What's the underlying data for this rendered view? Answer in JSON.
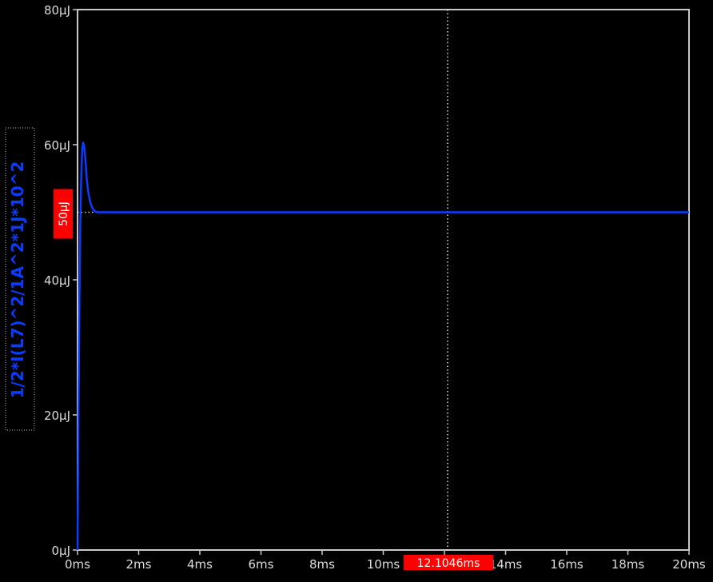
{
  "colors": {
    "background": "#000000",
    "axis": "#c8c8c8",
    "tick_text": "#dcdcdc",
    "trace": "#0a3cff",
    "cursor_line": "#ffffff",
    "cursor_label_bg": "#ff0000",
    "cursor_label_text": "#ffffff",
    "ylabel_text": "#0a3cff"
  },
  "chart_data": {
    "type": "line",
    "title": "",
    "xlabel": "",
    "ylabel": "1/2*I(L7)^2/1A^2*1J*10^2",
    "xlim": [
      0,
      20
    ],
    "ylim": [
      0,
      80
    ],
    "x_unit": "ms",
    "y_unit": "µJ",
    "xticks": [
      "0ms",
      "2ms",
      "4ms",
      "6ms",
      "8ms",
      "10ms",
      "12ms",
      "14ms",
      "16ms",
      "18ms",
      "20ms"
    ],
    "yticks": [
      "0µJ",
      "20µJ",
      "40µJ",
      "60µJ",
      "80µJ"
    ],
    "grid": false,
    "series": [
      {
        "x": [
          0,
          0.03,
          0.06,
          0.09,
          0.12,
          0.15,
          0.18,
          0.21,
          0.24,
          0.27,
          0.3,
          0.35,
          0.4,
          0.45,
          0.5,
          0.55,
          0.6,
          0.65,
          0.7,
          0.8,
          1.0,
          1.5,
          2,
          4,
          6,
          8,
          10,
          12,
          14,
          16,
          18,
          20
        ],
        "y": [
          0,
          20,
          36,
          48,
          55,
          59,
          60.3,
          60,
          58.8,
          57,
          55,
          53,
          51.8,
          51,
          50.5,
          50.2,
          50.1,
          50,
          50,
          50,
          50,
          50,
          50,
          50,
          50,
          50,
          50,
          50,
          50,
          50,
          50,
          50
        ]
      }
    ],
    "cursors": {
      "vertical": {
        "x": 12.1046,
        "label": "12.1046ms"
      },
      "horizontal": {
        "y": 50,
        "label": "50µJ"
      }
    }
  }
}
